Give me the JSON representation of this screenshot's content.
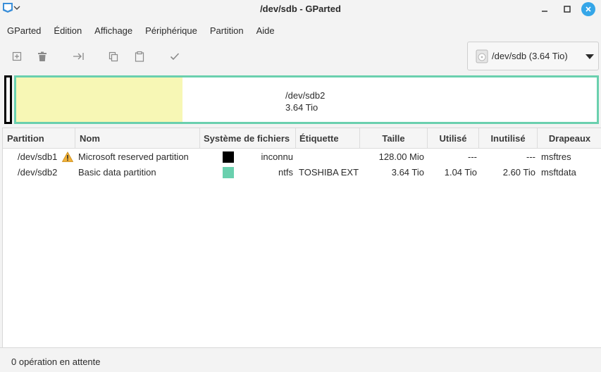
{
  "window": {
    "title": "/dev/sdb - GParted"
  },
  "menu": [
    {
      "label": "GParted"
    },
    {
      "label": "Édition"
    },
    {
      "label": "Affichage"
    },
    {
      "label": "Périphérique"
    },
    {
      "label": "Partition"
    },
    {
      "label": "Aide"
    }
  ],
  "toolbar": {
    "icons": [
      "new-partition-icon",
      "delete-icon",
      "resize-move-icon",
      "copy-icon",
      "paste-icon",
      "apply-check-icon"
    ]
  },
  "device_selector": {
    "label": "/dev/sdb (3.64 Tio)"
  },
  "disk_visual": {
    "partition_name": "/dev/sdb2",
    "partition_size": "3.64 Tio",
    "used_fraction": 0.286,
    "colors": {
      "unalloc_border": "#000000",
      "ntfs_border": "#6ad0ae",
      "used_fill": "#f7f7b5"
    }
  },
  "table": {
    "headers": {
      "partition": "Partition",
      "name": "Nom",
      "filesystem": "Système de fichiers",
      "label": "Étiquette",
      "size": "Taille",
      "used": "Utilisé",
      "unused": "Inutilisé",
      "flags": "Drapeaux"
    },
    "rows": [
      {
        "partition": "/dev/sdb1",
        "warning": true,
        "name": "Microsoft reserved partition",
        "fs_color": "#000000",
        "filesystem": "inconnu",
        "label": "",
        "size": "128.00 Mio",
        "used": "---",
        "unused": "---",
        "flags": "msftres"
      },
      {
        "partition": "/dev/sdb2",
        "warning": false,
        "name": "Basic data partition",
        "fs_color": "#6ad0ae",
        "filesystem": "ntfs",
        "label": "TOSHIBA EXT",
        "size": "3.64 Tio",
        "used": "1.04 Tio",
        "unused": "2.60 Tio",
        "flags": "msftdata"
      }
    ]
  },
  "status": {
    "text": "0 opération en attente"
  }
}
